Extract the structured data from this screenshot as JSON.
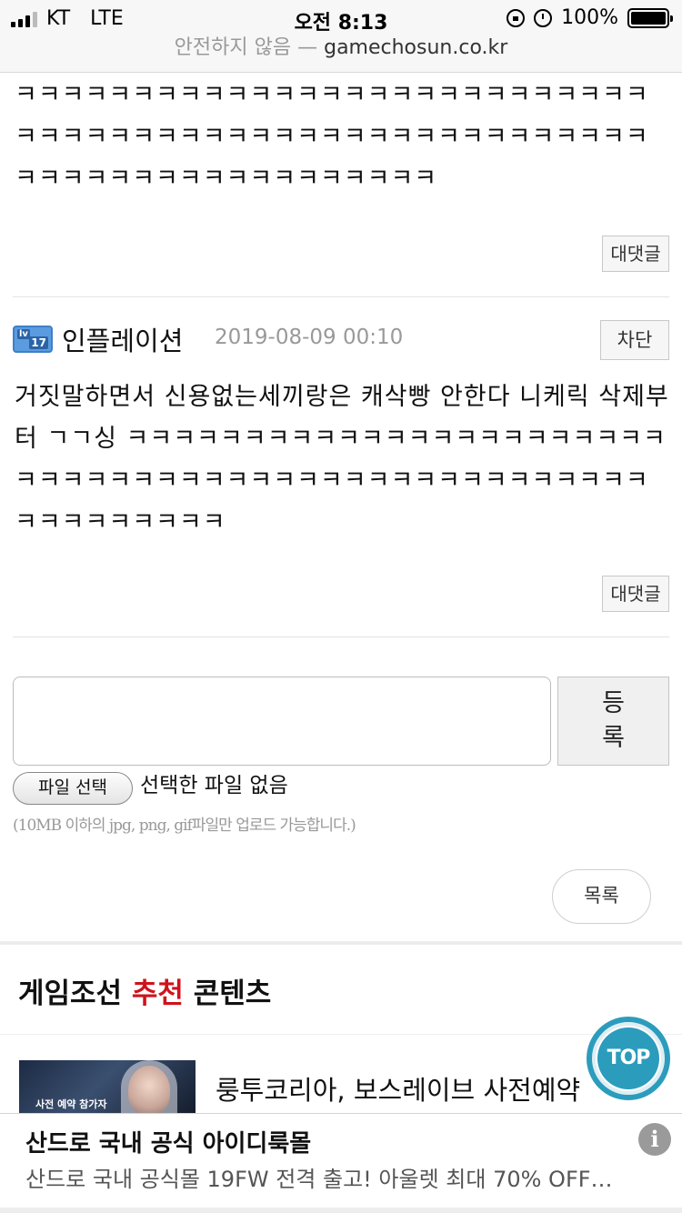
{
  "status_bar": {
    "carrier": "KT",
    "network": "LTE",
    "time": "오전 8:13",
    "battery": "100%",
    "icons": [
      "signal-icon",
      "orientation-lock-icon",
      "alarm-icon",
      "battery-icon"
    ]
  },
  "url_bar": {
    "security": "안전하지 않음 —",
    "domain": "gamechosun.co.kr"
  },
  "comments": [
    {
      "text": "ㅋㅋㅋㅋㅋㅋㅋㅋㅋㅋㅋㅋㅋㅋㅋㅋㅋㅋㅋㅋㅋㅋㅋㅋㅋㅋㅋㅋㅋㅋㅋㅋㅋㅋㅋㅋㅋㅋㅋㅋㅋㅋㅋㅋㅋㅋㅋㅋㅋㅋㅋㅋㅋㅋㅋㅋㅋㅋㅋㅋㅋㅋㅋㅋㅋㅋㅋㅋㅋㅋㅋㅋ",
      "reply_label": "대댓글"
    },
    {
      "nickname": "인플레이션",
      "level_badge": {
        "prefix": "lv",
        "number": "17"
      },
      "date": "2019-08-09 00:10",
      "block_label": "차단",
      "text": "거짓말하면서 신용없는세끼랑은 캐삭빵 안한다 니케릭 삭제부터 ㄱㄱ싱 ㅋㅋㅋㅋㅋㅋㅋㅋㅋㅋㅋㅋㅋㅋㅋㅋㅋㅋㅋㅋㅋㅋㅋㅋㅋㅋㅋㅋㅋㅋㅋㅋㅋㅋㅋㅋㅋㅋㅋㅋㅋㅋㅋㅋㅋㅋㅋㅋㅋㅋㅋㅋㅋㅋㅋㅋㅋㅋㅋ",
      "reply_label": "대댓글"
    }
  ],
  "write_form": {
    "textarea_value": "",
    "submit_label": "등록",
    "file_button": "파일 선택",
    "file_status": "선택한 파일 없음",
    "file_note": "(10MB 이하의 jpg, png, gif파일만 업로드 가능합니다.)"
  },
  "list_button": "목록",
  "recommend": {
    "title_prefix": "게임조선 ",
    "title_highlight": "추천",
    "title_suffix": " 콘텐츠",
    "highlight_color": "#d0121b",
    "item": {
      "title": "룽투코리아, 보스레이브 사전예약",
      "thumb_caption": "사전 예약 참가자"
    }
  },
  "top_button": "TOP",
  "ad": {
    "title": "산드로 국내 공식 아이디룩몰",
    "description": "산드로 국내 공식몰 19FW 전격 출고! 아울렛 최대 70% OFF…",
    "info_icon": "i"
  }
}
